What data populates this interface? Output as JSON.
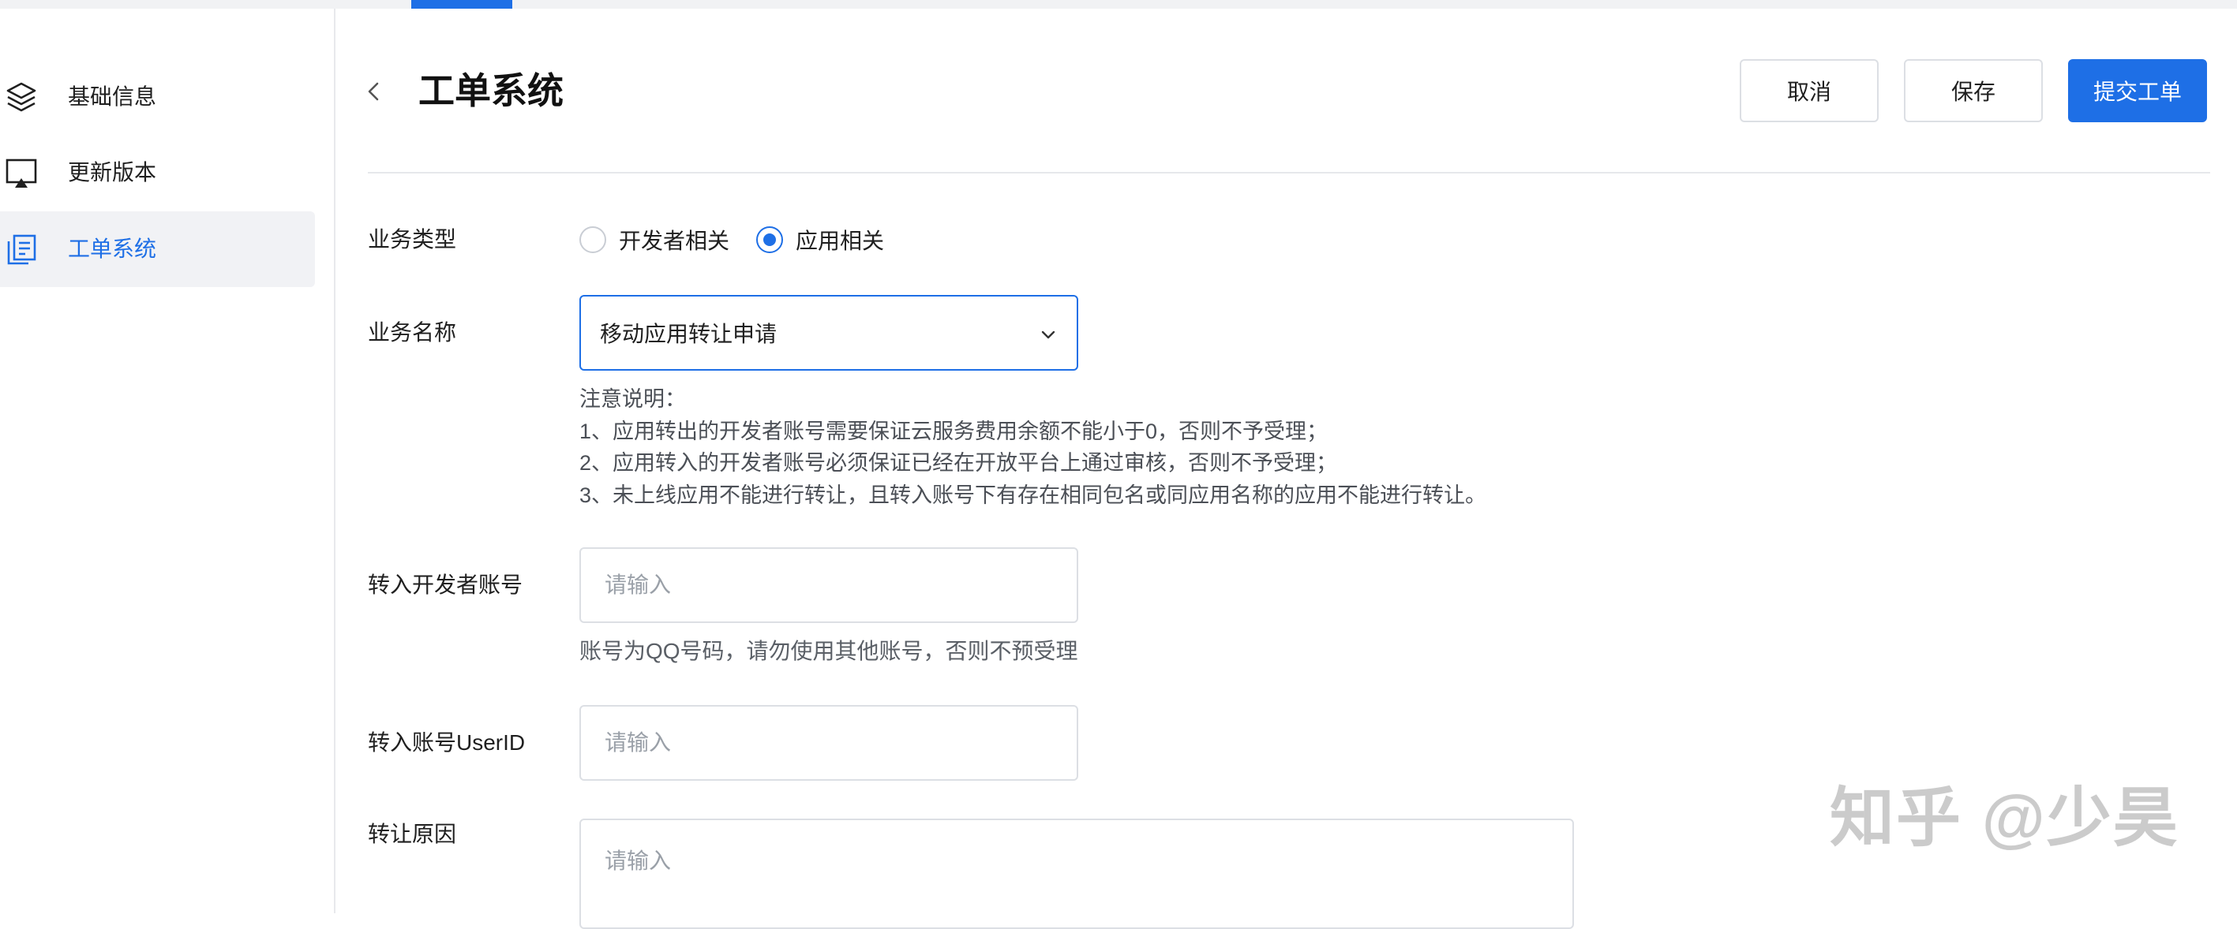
{
  "sidebar": {
    "items": [
      {
        "label": "基础信息",
        "icon": "layers-icon",
        "active": false
      },
      {
        "label": "更新版本",
        "icon": "screen-upload-icon",
        "active": false
      },
      {
        "label": "工单系统",
        "icon": "document-icon",
        "active": true
      }
    ]
  },
  "header": {
    "title": "工单系统",
    "cancel_label": "取消",
    "save_label": "保存",
    "submit_label": "提交工单"
  },
  "form": {
    "business_type": {
      "label": "业务类型",
      "options": [
        "开发者相关",
        "应用相关"
      ],
      "selected": "应用相关"
    },
    "business_name": {
      "label": "业务名称",
      "value": "移动应用转让申请"
    },
    "notes": {
      "title": "注意说明：",
      "lines": [
        "1、应用转出的开发者账号需要保证云服务费用余额不能小于0，否则不予受理；",
        "2、应用转入的开发者账号必须保证已经在开放平台上通过审核，否则不予受理；",
        "3、未上线应用不能进行转让，且转入账号下有存在相同包名或同应用名称的应用不能进行转让。"
      ]
    },
    "target_account": {
      "label": "转入开发者账号",
      "placeholder": "请输入",
      "hint": "账号为QQ号码，请勿使用其他账号，否则不预受理"
    },
    "target_userid": {
      "label": "转入账号UserID",
      "placeholder": "请输入"
    },
    "reason": {
      "label": "转让原因",
      "placeholder": "请输入"
    }
  },
  "watermark": "知乎 @少昊",
  "colors": {
    "accent": "#1e6fe6",
    "sidebar_active_bg": "#f1f2f5",
    "border": "#dcdfe4"
  }
}
